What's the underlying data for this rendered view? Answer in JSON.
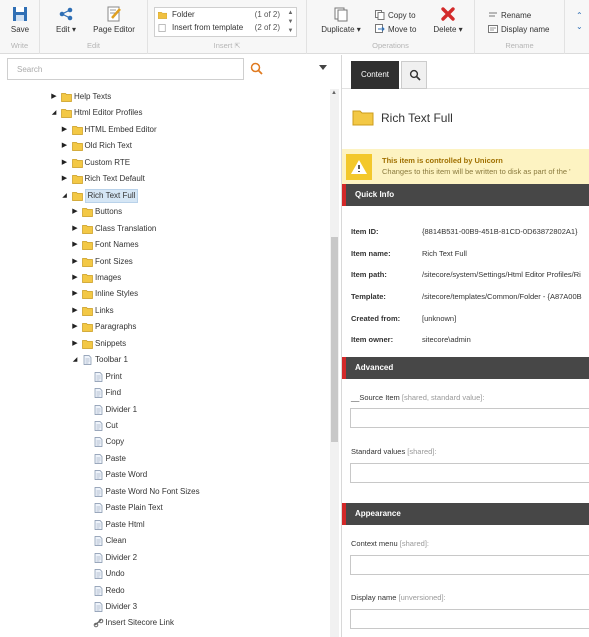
{
  "ribbon": {
    "write": {
      "group": "Write",
      "save": "Save"
    },
    "edit": {
      "group": "Edit",
      "edit": "Edit ▾",
      "page_editor": "Page Editor"
    },
    "insert": {
      "group": "Insert",
      "options": [
        {
          "label": "Folder",
          "count": "(1 of 2)"
        },
        {
          "label": "Insert from template",
          "count": "(2 of 2)"
        }
      ]
    },
    "operations": {
      "group": "Operations",
      "duplicate": "Duplicate ▾",
      "copy_to": "Copy to",
      "move_to": "Move to",
      "delete": "Delete ▾"
    },
    "rename": {
      "group": "Rename",
      "rename": "Rename",
      "display_name": "Display name"
    }
  },
  "search": {
    "placeholder": "Search"
  },
  "tree": [
    {
      "label": "Help Texts",
      "expander": "closed",
      "icon": "folder"
    },
    {
      "label": "Html Editor Profiles",
      "expander": "open",
      "icon": "folder"
    },
    {
      "label": "HTML Embed Editor",
      "expander": "closed",
      "icon": "folder"
    },
    {
      "label": "Old Rich Text",
      "expander": "closed",
      "icon": "folder"
    },
    {
      "label": "Custom RTE",
      "expander": "closed",
      "icon": "folder"
    },
    {
      "label": "Rich Text Default",
      "expander": "closed",
      "icon": "folder"
    },
    {
      "label": "Rich Text Full",
      "expander": "open",
      "icon": "folder",
      "selected": true
    },
    {
      "label": "Buttons",
      "expander": "closed",
      "icon": "folder"
    },
    {
      "label": "Class Translation",
      "expander": "closed",
      "icon": "folder"
    },
    {
      "label": "Font Names",
      "expander": "closed",
      "icon": "folder"
    },
    {
      "label": "Font Sizes",
      "expander": "closed",
      "icon": "folder"
    },
    {
      "label": "Images",
      "expander": "closed",
      "icon": "folder"
    },
    {
      "label": "Inline Styles",
      "expander": "closed",
      "icon": "folder"
    },
    {
      "label": "Links",
      "expander": "closed",
      "icon": "folder"
    },
    {
      "label": "Paragraphs",
      "expander": "closed",
      "icon": "folder"
    },
    {
      "label": "Snippets",
      "expander": "closed",
      "icon": "folder"
    },
    {
      "label": "Toolbar 1",
      "expander": "open",
      "icon": "document"
    },
    {
      "label": "Print",
      "expander": "none",
      "icon": "document"
    },
    {
      "label": "Find",
      "expander": "none",
      "icon": "document"
    },
    {
      "label": "Divider 1",
      "expander": "none",
      "icon": "document"
    },
    {
      "label": "Cut",
      "expander": "none",
      "icon": "document"
    },
    {
      "label": "Copy",
      "expander": "none",
      "icon": "document"
    },
    {
      "label": "Paste",
      "expander": "none",
      "icon": "document"
    },
    {
      "label": "Paste Word",
      "expander": "none",
      "icon": "document"
    },
    {
      "label": "Paste Word No Font Sizes",
      "expander": "none",
      "icon": "document"
    },
    {
      "label": "Paste Plain Text",
      "expander": "none",
      "icon": "document"
    },
    {
      "label": "Paste Html",
      "expander": "none",
      "icon": "document"
    },
    {
      "label": "Clean",
      "expander": "none",
      "icon": "document"
    },
    {
      "label": "Divider 2",
      "expander": "none",
      "icon": "document"
    },
    {
      "label": "Undo",
      "expander": "none",
      "icon": "document"
    },
    {
      "label": "Redo",
      "expander": "none",
      "icon": "document"
    },
    {
      "label": "Divider 3",
      "expander": "none",
      "icon": "document"
    },
    {
      "label": "Insert Sitecore Link",
      "expander": "none",
      "icon": "link"
    }
  ],
  "tabs": {
    "content": "Content"
  },
  "item": {
    "title": "Rich Text Full"
  },
  "warning": {
    "title": "This item is controlled by Unicorn",
    "text": "Changes to this item will be written to disk as part of the '"
  },
  "sections": {
    "quick_info": "Quick Info",
    "advanced": "Advanced",
    "appearance": "Appearance"
  },
  "quick_info": [
    {
      "key": "Item ID:",
      "value": "{8814B531-00B9-451B-81CD-0D63872802A1}"
    },
    {
      "key": "Item name:",
      "value": "Rich Text Full"
    },
    {
      "key": "Item path:",
      "value": "/sitecore/system/Settings/Html Editor Profiles/Ri"
    },
    {
      "key": "Template:",
      "value": "/sitecore/templates/Common/Folder - {A87A00B"
    },
    {
      "key": "Created from:",
      "value": "[unknown]"
    },
    {
      "key": "Item owner:",
      "value": "sitecore\\admin"
    }
  ],
  "fields": {
    "source_item": {
      "label": "__Source Item",
      "meta": "[shared, standard value]:"
    },
    "standard_values": {
      "label": "Standard values",
      "meta": "[shared]:"
    },
    "context_menu": {
      "label": "Context menu",
      "meta": "[shared]:"
    },
    "display_name": {
      "label": "Display name",
      "meta": "[unversioned]:"
    }
  },
  "colors": {
    "section_accent": "#d22828",
    "warning_bg": "#fdf3c2",
    "selected_bg": "#d5e6f5"
  }
}
